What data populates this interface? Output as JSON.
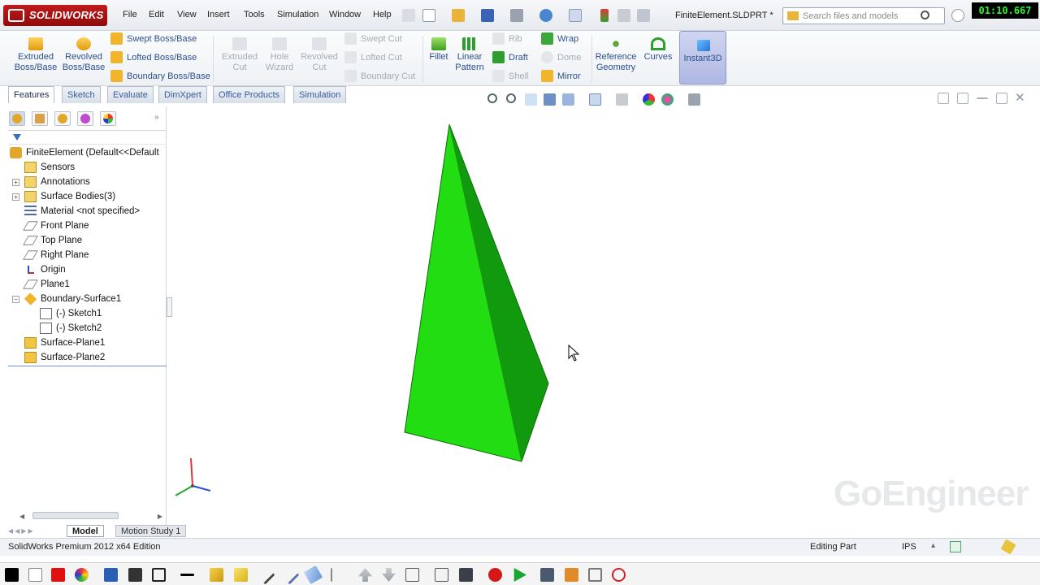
{
  "app": {
    "brand": "SOLIDWORKS",
    "document_title": "FiniteElement.SLDPRT *",
    "timer": "01:10.667"
  },
  "menu": [
    "File",
    "Edit",
    "View",
    "Insert",
    "Tools",
    "Simulation",
    "Window",
    "Help"
  ],
  "search": {
    "placeholder": "Search files and models"
  },
  "command_manager": {
    "extruded_boss": [
      "Extruded",
      "Boss/Base"
    ],
    "revolved_boss": [
      "Revolved",
      "Boss/Base"
    ],
    "swept_boss": "Swept Boss/Base",
    "lofted_boss": "Lofted Boss/Base",
    "boundary_boss": "Boundary Boss/Base",
    "extruded_cut": [
      "Extruded",
      "Cut"
    ],
    "hole_wizard": [
      "Hole",
      "Wizard"
    ],
    "revolved_cut": [
      "Revolved",
      "Cut"
    ],
    "swept_cut": "Swept Cut",
    "lofted_cut": "Lofted Cut",
    "boundary_cut": "Boundary Cut",
    "fillet": "Fillet",
    "linear_pattern": [
      "Linear",
      "Pattern"
    ],
    "rib": "Rib",
    "draft": "Draft",
    "shell": "Shell",
    "wrap": "Wrap",
    "dome": "Dome",
    "mirror": "Mirror",
    "reference_geometry": [
      "Reference",
      "Geometry"
    ],
    "curves": "Curves",
    "instant3d": "Instant3D"
  },
  "tabs": [
    "Features",
    "Sketch",
    "Evaluate",
    "DimXpert",
    "Office Products",
    "Simulation"
  ],
  "active_tab": "Features",
  "tree": {
    "root": "FiniteElement  (Default<<Default",
    "items": [
      "Sensors",
      "Annotations",
      "Surface Bodies(3)",
      "Material <not specified>",
      "Front Plane",
      "Top Plane",
      "Right Plane",
      "Origin",
      "Plane1",
      "Boundary-Surface1",
      "(-) Sketch1",
      "(-) Sketch2",
      "Surface-Plane1",
      "Surface-Plane2"
    ]
  },
  "bottom_tabs": [
    "Model",
    "Motion Study 1"
  ],
  "status_bar": {
    "left": "SolidWorks Premium 2012 x64 Edition",
    "mode": "Editing Part",
    "units": "IPS"
  },
  "watermark": "GoEngineer",
  "colors": {
    "part_front": "#22dd11",
    "part_side": "#129a0e",
    "accent_blue": "#2d4f8e",
    "brand_red": "#c11a1a"
  }
}
